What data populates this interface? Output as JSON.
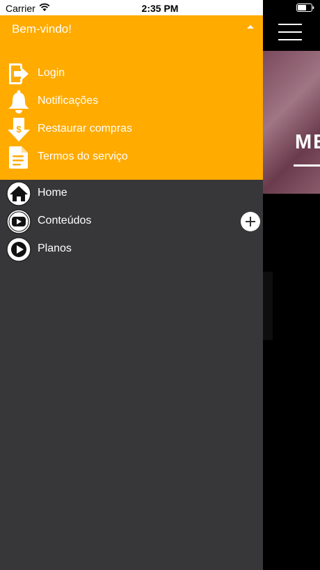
{
  "status_bar": {
    "carrier": "Carrier",
    "time": "2:35 PM"
  },
  "background_app": {
    "hero_text": "ME"
  },
  "drawer": {
    "header": {
      "welcome": "Bem-vindo!",
      "background_color": "#ffab00",
      "items": [
        {
          "label": "Login",
          "icon": "login-icon"
        },
        {
          "label": "Notificações",
          "icon": "bell-icon"
        },
        {
          "label": "Restaurar compras",
          "icon": "restore-purchase-icon"
        },
        {
          "label": "Termos do serviço",
          "icon": "document-icon"
        }
      ]
    },
    "nav": {
      "background_color": "#37373a",
      "items": [
        {
          "label": "Home",
          "icon": "home-icon"
        },
        {
          "label": "Conteúdos",
          "icon": "youtube-play-icon",
          "expand": "plus-icon"
        },
        {
          "label": "Planos",
          "icon": "play-circle-icon"
        }
      ]
    }
  }
}
